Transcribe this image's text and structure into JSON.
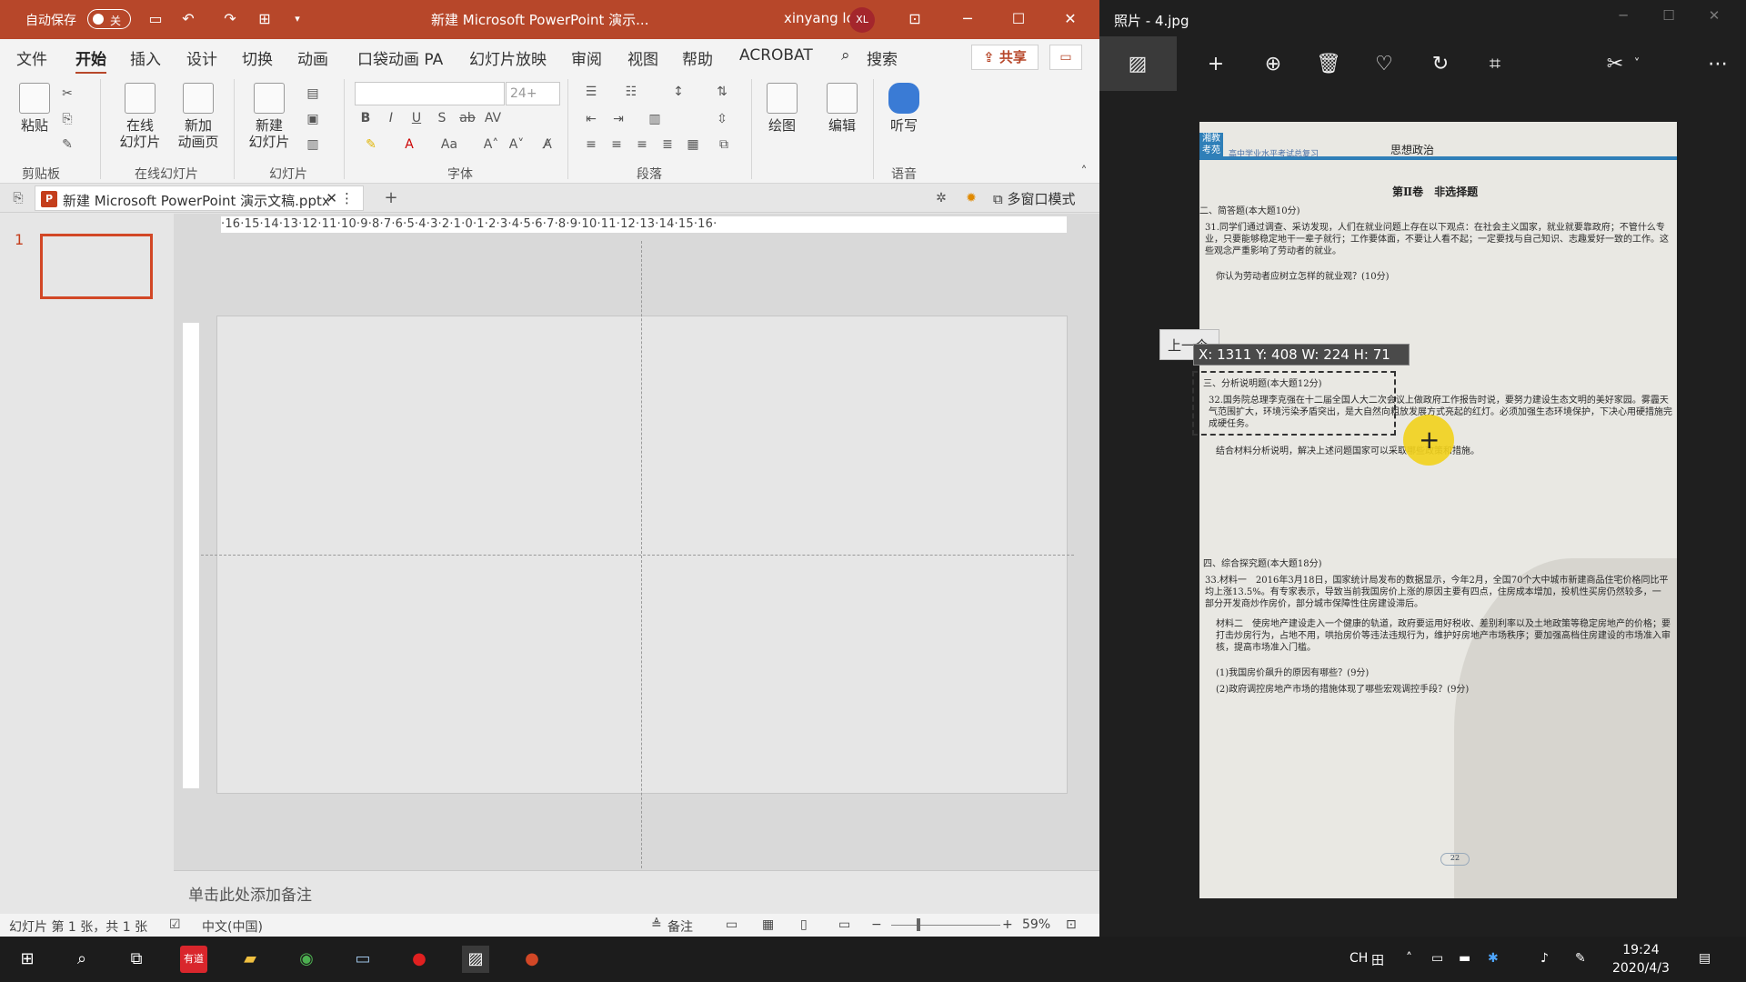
{
  "ppt": {
    "autosave_label": "自动保存",
    "autosave_state": "关",
    "title": "新建 Microsoft PowerPoint 演示...",
    "user": "xinyang long",
    "avatar": "XL",
    "menu": [
      "文件",
      "开始",
      "插入",
      "设计",
      "切换",
      "动画",
      "口袋动画 PA",
      "幻灯片放映",
      "审阅",
      "视图",
      "帮助",
      "ACROBAT",
      "搜索"
    ],
    "share": "共享",
    "ribbon": {
      "paste": "粘贴",
      "online": "在线\n幻灯片",
      "newanim": "新加\n动画页",
      "newslide": "新建\n幻灯片",
      "fontsize": "24+",
      "draw": "绘图",
      "edit": "编辑",
      "dictate": "听写",
      "groups": [
        "剪贴板",
        "在线幻灯片",
        "幻灯片",
        "字体",
        "段落",
        "语音"
      ]
    },
    "tab": {
      "name": "新建 Microsoft PowerPoint 演示文稿.pptx",
      "window_mode": "多窗口模式"
    },
    "ruler": "·16·15·14·13·12·11·10·9·8·7·6·5·4·3·2·1·0·1·2·3·4·5·6·7·8·9·10·11·12·13·14·15·16·",
    "slide_num": "1",
    "notes": "单击此处添加备注",
    "status": {
      "slide": "幻灯片 第 1 张，共 1 张",
      "lang": "中文(中国)",
      "notes": "备注",
      "zoom": "59%"
    }
  },
  "photos": {
    "title": "照片 - 4.jpg",
    "prev_tip": "上一个",
    "coords": "X: 1311 Y: 408 W: 224 H: 71",
    "doc": {
      "badge": "湘教考苑",
      "header_small": "高中学业水平考试总复习",
      "subject": "思想政治",
      "part": "第Ⅱ卷　非选择题",
      "sec2": "二、简答题(本大题10分)",
      "q31": "31.同学们通过调查、采访发现，人们在就业问题上存在以下观点：在社会主义国家，就业就要靠政府；不管什么专业，只要能够稳定地干一辈子就行；工作要体面，不要让人看不起；一定要找与自己知识、志趣爱好一致的工作。这些观念严重影响了劳动者的就业。",
      "q31b": "你认为劳动者应树立怎样的就业观？(10分)",
      "sec3": "三、分析说明题(本大题12分)",
      "q32": "32.国务院总理李克强在十二届全国人大二次会议上做政府工作报告时说，要努力建设生态文明的美好家园。雾霾天气范围扩大，环境污染矛盾突出，是大自然向粗放发展方式亮起的红灯。必须加强生态环境保护，下决心用硬措施完成硬任务。",
      "q32b": "结合材料分析说明，解决上述问题国家可以采取哪些政策和措施。",
      "sec4": "四、综合探究题(本大题18分)",
      "q33": "33.材料一　2016年3月18日，国家统计局发布的数据显示，今年2月，全国70个大中城市新建商品住宅价格同比平均上涨13.5%。有专家表示，导致当前我国房价上涨的原因主要有四点，住房成本增加，投机性买房仍然较多，一部分开发商炒作房价，部分城市保障性住房建设滞后。",
      "q33b": "材料二　使房地产建设走入一个健康的轨道，政府要运用好税收、差别利率以及土地政策等稳定房地产的价格；要打击炒房行为，占地不用，哄抬房价等违法违规行为，维护好房地产市场秩序；要加强高档住房建设的市场准入审核，提高市场准入门槛。",
      "q33c": "(1)我国房价飙升的原因有哪些？(9分)",
      "q33d": "(2)政府调控房地产市场的措施体现了哪些宏观调控手段？(9分)",
      "page": "22"
    }
  },
  "taskbar": {
    "ime": "CH",
    "time": "19:24",
    "date": "2020/4/3",
    "app_dict": "有道"
  },
  "colors": {
    "ppt_accent": "#b7472a",
    "cursor": "#f2d21b"
  }
}
